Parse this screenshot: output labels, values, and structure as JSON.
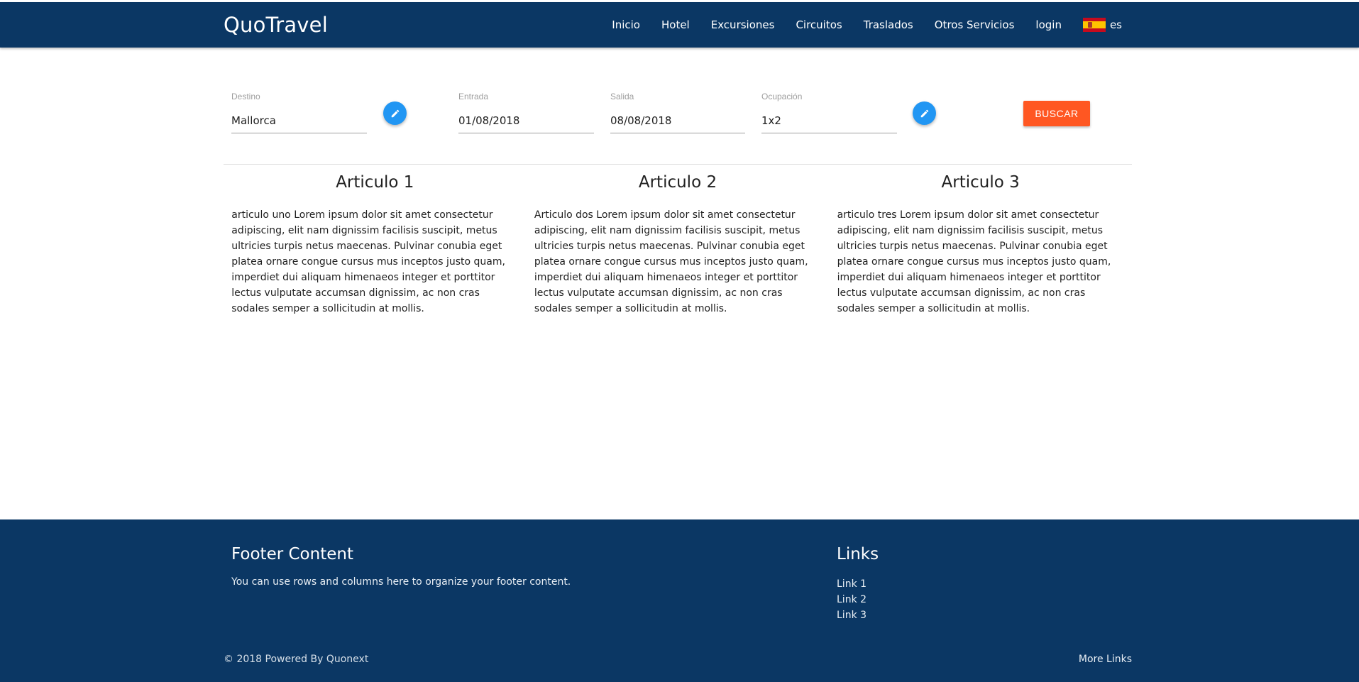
{
  "nav": {
    "brand": "QuoTravel",
    "links": [
      "Inicio",
      "Hotel",
      "Excursiones",
      "Circuitos",
      "Traslados",
      "Otros Servicios",
      "login"
    ],
    "language": "es",
    "flag_icon": "spain-flag-icon"
  },
  "search": {
    "destino": {
      "label": "Destino",
      "value": "Mallorca"
    },
    "entrada": {
      "label": "Entrada",
      "value": "01/08/2018"
    },
    "salida": {
      "label": "Salida",
      "value": "08/08/2018"
    },
    "ocupacion": {
      "label": "Ocupación",
      "value": "1x2"
    },
    "edit_icon": "pencil-icon",
    "button_label": "BUSCAR"
  },
  "articles": [
    {
      "title": "Articulo 1",
      "body": "articulo uno Lorem ipsum dolor sit amet consectetur adipiscing, elit nam dignissim facilisis suscipit, metus ultricies turpis netus maecenas. Pulvinar conubia eget platea ornare congue cursus mus inceptos justo quam, imperdiet dui aliquam himenaeos integer et porttitor lectus vulputate accumsan dignissim, ac non cras sodales semper a sollicitudin at mollis."
    },
    {
      "title": "Articulo 2",
      "body": "Articulo dos Lorem ipsum dolor sit amet consectetur adipiscing, elit nam dignissim facilisis suscipit, metus ultricies turpis netus maecenas. Pulvinar conubia eget platea ornare congue cursus mus inceptos justo quam, imperdiet dui aliquam himenaeos integer et porttitor lectus vulputate accumsan dignissim, ac non cras sodales semper a sollicitudin at mollis."
    },
    {
      "title": "Articulo 3",
      "body": "articulo tres Lorem ipsum dolor sit amet consectetur adipiscing, elit nam dignissim facilisis suscipit, metus ultricies turpis netus maecenas. Pulvinar conubia eget platea ornare congue cursus mus inceptos justo quam, imperdiet dui aliquam himenaeos integer et porttitor lectus vulputate accumsan dignissim, ac non cras sodales semper a sollicitudin at mollis."
    }
  ],
  "footer": {
    "title": "Footer Content",
    "text": "You can use rows and columns here to organize your footer content.",
    "links_title": "Links",
    "links": [
      "Link 1",
      "Link 2",
      "Link 3"
    ],
    "copyright": "© 2018 Powered By Quonext",
    "more_links": "More Links"
  },
  "colors": {
    "primary": "#0b3764",
    "accent": "#ff5722",
    "fab": "#2196f3"
  }
}
